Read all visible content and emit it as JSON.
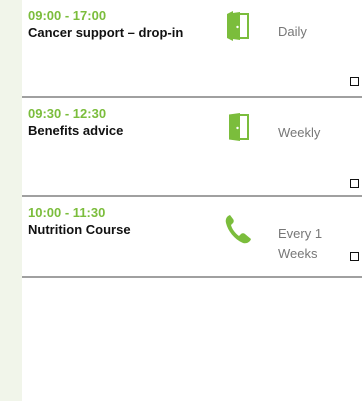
{
  "sessions": [
    {
      "time": "09:00 - 17:00",
      "title": "Cancer support – drop-in",
      "type_icon": "door-icon",
      "frequency": "Daily"
    },
    {
      "time": "09:30 - 12:30",
      "title": "Benefits advice",
      "type_icon": "door-icon",
      "frequency": "Weekly"
    },
    {
      "time": "10:00 - 11:30",
      "title": "Nutrition Course",
      "type_icon": "phone-icon",
      "frequency": "Every 1 Weeks"
    }
  ],
  "colors": {
    "accent": "#7bbd3c",
    "sidebar": "#f1f5ea",
    "divider": "#a0a0a0",
    "muted_text": "#777777"
  }
}
